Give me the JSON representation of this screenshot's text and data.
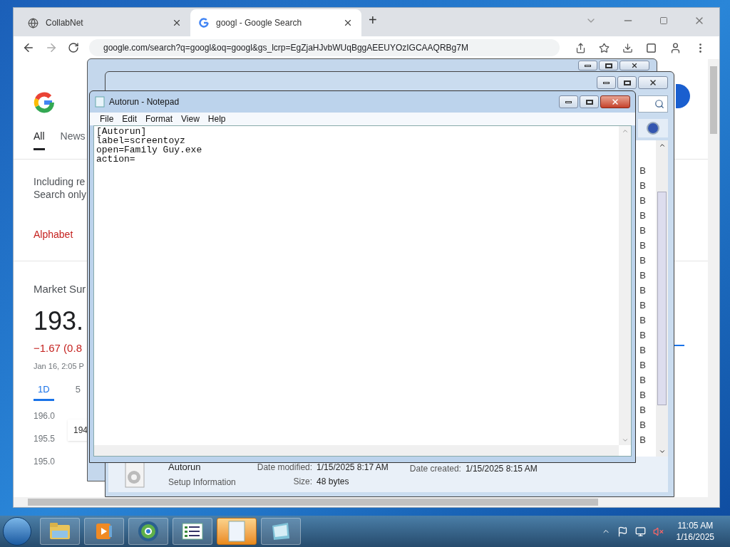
{
  "browser": {
    "tabs": [
      {
        "title": "CollabNet",
        "selected": false
      },
      {
        "title": "googl - Google Search",
        "selected": true
      }
    ],
    "new_tab": "+",
    "address": "google.com/search?q=googl&oq=googl&gs_lcrp=EgZjaHJvbWUqBggAEEUYOzIGCAAQRBg7M",
    "nav_tabs": [
      {
        "label": "All",
        "selected": true
      },
      {
        "label": "News",
        "selected": false
      }
    ],
    "notice_lines": [
      "Including re",
      "Search only"
    ],
    "entity": "Alphabet",
    "market": {
      "title": "Market Sur",
      "price": "193.",
      "change": "−1.67 (0.8",
      "time": "Jan 16, 2:05 P",
      "ranges": [
        {
          "label": "1D",
          "selected": true
        },
        {
          "label": "5",
          "selected": false
        }
      ],
      "y_labels": [
        "196.0",
        "195.5",
        "195.0"
      ],
      "tooltip": "194"
    }
  },
  "explorer": {
    "size_cells": [
      "B",
      "B",
      "B",
      "B",
      "B",
      "B",
      "B",
      "B",
      "B",
      "B",
      "B",
      "B",
      "B",
      "B",
      "B",
      "B",
      "B",
      "B",
      "B"
    ],
    "details": {
      "name": "Autorun",
      "type": "Setup Information",
      "modified_label": "Date modified:",
      "modified": "1/15/2025 8:17 AM",
      "created_label": "Date created:",
      "created": "1/15/2025 8:15 AM",
      "size_label": "Size:",
      "size": "48 bytes"
    }
  },
  "notepad": {
    "title": "Autorun - Notepad",
    "menu": [
      "File",
      "Edit",
      "Format",
      "View",
      "Help"
    ],
    "lines": [
      "[Autorun]",
      "label=screentoyz",
      "open=Family Guy.exe",
      "action="
    ]
  },
  "taskbar": {
    "items": [
      {
        "kind": "folder",
        "selected": false
      },
      {
        "kind": "media",
        "selected": false
      },
      {
        "kind": "globe",
        "selected": false
      },
      {
        "kind": "list",
        "selected": false
      },
      {
        "kind": "page",
        "selected": true
      },
      {
        "kind": "notepad",
        "selected": false
      }
    ],
    "time": "11:05 AM",
    "date": "1/16/2025"
  }
}
